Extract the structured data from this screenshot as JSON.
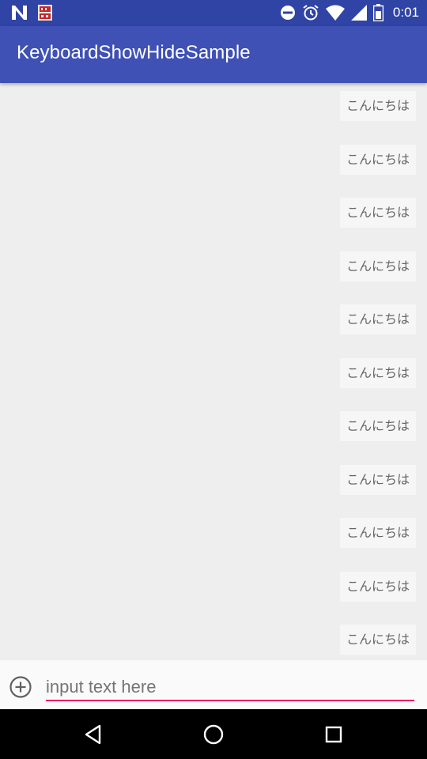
{
  "status_bar": {
    "time": "0:01",
    "left_icons": [
      "n-notification-icon",
      "hd-on-notification-icon"
    ],
    "right_icons": [
      "do-not-disturb-icon",
      "alarm-clock-icon",
      "wifi-icon",
      "cellular-signal-icon",
      "battery-icon"
    ]
  },
  "app_bar": {
    "title": "KeyboardShowHideSample",
    "color": "#3f51b5"
  },
  "messages": [
    {
      "text": "こんにちは"
    },
    {
      "text": "こんにちは"
    },
    {
      "text": "こんにちは"
    },
    {
      "text": "こんにちは"
    },
    {
      "text": "こんにちは"
    },
    {
      "text": "こんにちは"
    },
    {
      "text": "こんにちは"
    },
    {
      "text": "こんにちは"
    },
    {
      "text": "こんにちは"
    },
    {
      "text": "こんにちは"
    },
    {
      "text": "こんにちは"
    }
  ],
  "input_bar": {
    "placeholder": "input text here",
    "value": "",
    "add_icon": "add-circle-icon",
    "accent_color": "#e91e63"
  },
  "nav_bar": {
    "icons": [
      "back-triangle-icon",
      "home-circle-icon",
      "recents-square-icon"
    ]
  }
}
